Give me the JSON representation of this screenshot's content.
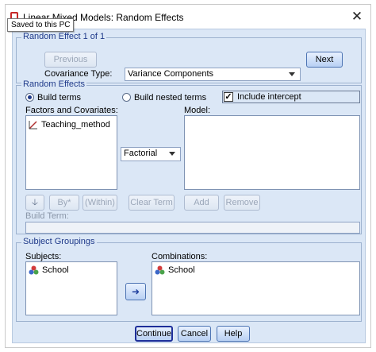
{
  "window": {
    "title": "Linear Mixed Models: Random Effects",
    "close_glyph": "✕",
    "tooltip": "Saved to this PC"
  },
  "random_effect": {
    "group_label": "Random Effect 1 of 1",
    "previous_label": "Previous",
    "next_label": "Next",
    "covariance_label": "Covariance Type:",
    "covariance_value": "Variance Components"
  },
  "random_effects": {
    "group_label": "Random Effects",
    "build_terms_label": "Build terms",
    "build_nested_label": "Build nested terms",
    "build_terms_selected": true,
    "include_intercept_label": "Include intercept",
    "include_intercept_checked": true,
    "factors_label": "Factors and Covariates:",
    "factors": [
      {
        "name": "Teaching_method",
        "icon": "scale-icon"
      }
    ],
    "model_label": "Model:",
    "term_type_value": "Factorial",
    "move_down_glyph": "🡣",
    "by_label": "By*",
    "within_label": "(Within)",
    "clear_term_label": "Clear Term",
    "add_label": "Add",
    "remove_label": "Remove",
    "build_term_label": "Build Term:"
  },
  "subject_groupings": {
    "group_label": "Subject Groupings",
    "subjects_label": "Subjects:",
    "subjects": [
      {
        "name": "School",
        "icon": "nominal-icon"
      }
    ],
    "combinations_label": "Combinations:",
    "combinations": [
      {
        "name": "School",
        "icon": "nominal-icon"
      }
    ],
    "move_glyph": "➜"
  },
  "footer": {
    "continue_label": "Continue",
    "cancel_label": "Cancel",
    "help_label": "Help"
  },
  "colors": {
    "dialog_background": "#dbe7f6",
    "group_label": "#1f3a8a",
    "default_button_border": "#1e2f9a"
  }
}
